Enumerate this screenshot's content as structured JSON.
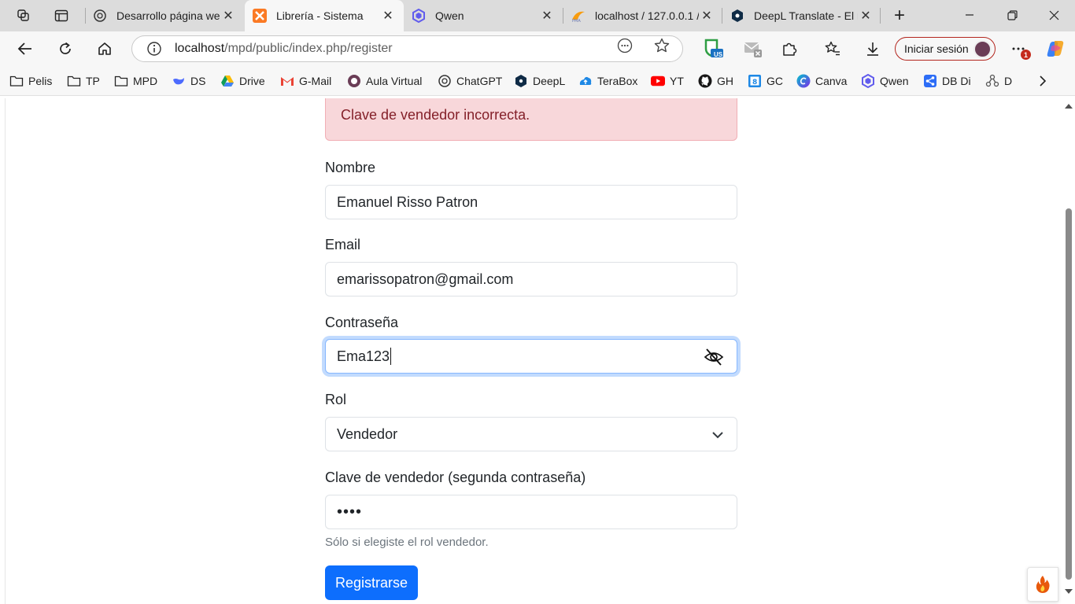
{
  "browser": {
    "tabs": [
      {
        "title": "Desarrollo página web",
        "active": false
      },
      {
        "title": "Librería - Sistema",
        "active": true
      },
      {
        "title": "Qwen",
        "active": false
      },
      {
        "title": "localhost / 127.0.0.1 /",
        "active": false
      },
      {
        "title": "DeepL Translate - El m",
        "active": false
      }
    ],
    "new_tab": "+",
    "address": {
      "host": "localhost",
      "path": "/mpd/public/index.php/register"
    },
    "signin_label": "Iniciar sesión",
    "notification_count": "1",
    "bookmarks": [
      "Pelis",
      "TP",
      "MPD",
      "DS",
      "Drive",
      "G-Mail",
      "Aula Virtual",
      "ChatGPT",
      "DeepL",
      "TeraBox",
      "YT",
      "GH",
      "GC",
      "Canva",
      "Qwen",
      "DB Di",
      "D"
    ],
    "extension_badge": "US"
  },
  "form": {
    "alert": "Clave de vendedor incorrecta.",
    "nombre_label": "Nombre",
    "nombre_value": "Emanuel Risso Patron",
    "email_label": "Email",
    "email_value": "emarissopatron@gmail.com",
    "password_label": "Contraseña",
    "password_value": "Ema123",
    "rol_label": "Rol",
    "rol_value": "Vendedor",
    "clave_label": "Clave de vendedor (segunda contraseña)",
    "clave_value": "••••",
    "clave_help": "Sólo si elegiste el rol vendedor.",
    "submit_label": "Registrarse"
  },
  "colors": {
    "alert_bg": "#f8d7da",
    "alert_text": "#842029",
    "primary": "#0d6efd",
    "focus_border": "#86b7fe"
  }
}
